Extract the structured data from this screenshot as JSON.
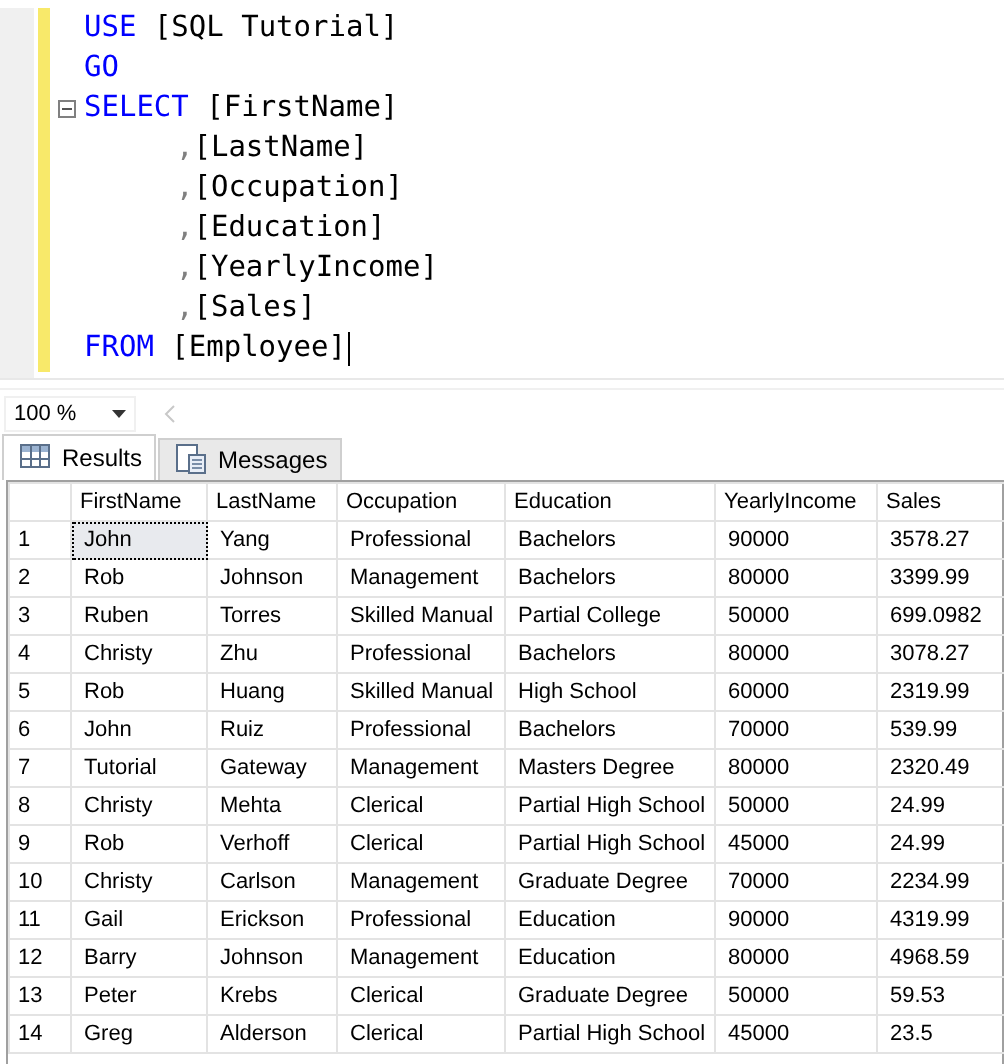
{
  "editor": {
    "lines": [
      {
        "kind": "plain",
        "fold": false,
        "cursor": false,
        "tokens": [
          {
            "text": "USE",
            "kind": "keyword"
          },
          {
            "text": "[SQL Tutorial]",
            "kind": "ident"
          }
        ]
      },
      {
        "kind": "plain",
        "fold": false,
        "cursor": false,
        "tokens": [
          {
            "text": "GO",
            "kind": "keyword"
          }
        ]
      },
      {
        "kind": "plain",
        "fold": true,
        "cursor": false,
        "tokens": [
          {
            "text": "SELECT",
            "kind": "keyword"
          },
          {
            "text": "[FirstName]",
            "kind": "ident"
          }
        ]
      },
      {
        "kind": "continuation",
        "fold": false,
        "cursor": false,
        "tokens": [
          {
            "text": ",",
            "kind": "punct"
          },
          {
            "text": "[LastName]",
            "kind": "ident"
          }
        ]
      },
      {
        "kind": "continuation",
        "fold": false,
        "cursor": false,
        "tokens": [
          {
            "text": ",",
            "kind": "punct"
          },
          {
            "text": "[Occupation]",
            "kind": "ident"
          }
        ]
      },
      {
        "kind": "continuation",
        "fold": false,
        "cursor": false,
        "tokens": [
          {
            "text": ",",
            "kind": "punct"
          },
          {
            "text": "[Education]",
            "kind": "ident"
          }
        ]
      },
      {
        "kind": "continuation",
        "fold": false,
        "cursor": false,
        "tokens": [
          {
            "text": ",",
            "kind": "punct"
          },
          {
            "text": "[YearlyIncome]",
            "kind": "ident"
          }
        ]
      },
      {
        "kind": "continuation",
        "fold": false,
        "cursor": false,
        "tokens": [
          {
            "text": ",",
            "kind": "punct"
          },
          {
            "text": "[Sales]",
            "kind": "ident"
          }
        ]
      },
      {
        "kind": "plain",
        "fold": false,
        "cursor": true,
        "tokens": [
          {
            "text": "FROM",
            "kind": "keyword"
          },
          {
            "text": "[Employee]",
            "kind": "ident"
          }
        ]
      }
    ]
  },
  "zoom": {
    "value": "100 %"
  },
  "tabs": [
    {
      "label": "Results",
      "selected": true
    },
    {
      "label": "Messages",
      "selected": false
    }
  ],
  "table": {
    "columns": [
      "FirstName",
      "LastName",
      "Occupation",
      "Education",
      "YearlyIncome",
      "Sales"
    ],
    "rows": [
      {
        "number": "1",
        "focused": true,
        "cells": [
          "John",
          "Yang",
          "Professional",
          "Bachelors",
          "90000",
          "3578.27"
        ]
      },
      {
        "number": "2",
        "focused": false,
        "cells": [
          "Rob",
          "Johnson",
          "Management",
          "Bachelors",
          "80000",
          "3399.99"
        ]
      },
      {
        "number": "3",
        "focused": false,
        "cells": [
          "Ruben",
          "Torres",
          "Skilled Manual",
          "Partial College",
          "50000",
          "699.0982"
        ]
      },
      {
        "number": "4",
        "focused": false,
        "cells": [
          "Christy",
          "Zhu",
          "Professional",
          "Bachelors",
          "80000",
          "3078.27"
        ]
      },
      {
        "number": "5",
        "focused": false,
        "cells": [
          "Rob",
          "Huang",
          "Skilled Manual",
          "High School",
          "60000",
          "2319.99"
        ]
      },
      {
        "number": "6",
        "focused": false,
        "cells": [
          "John",
          "Ruiz",
          "Professional",
          "Bachelors",
          "70000",
          "539.99"
        ]
      },
      {
        "number": "7",
        "focused": false,
        "cells": [
          "Tutorial",
          "Gateway",
          "Management",
          "Masters Degree",
          "80000",
          "2320.49"
        ]
      },
      {
        "number": "8",
        "focused": false,
        "cells": [
          "Christy",
          "Mehta",
          "Clerical",
          "Partial High School",
          "50000",
          "24.99"
        ]
      },
      {
        "number": "9",
        "focused": false,
        "cells": [
          "Rob",
          "Verhoff",
          "Clerical",
          "Partial High School",
          "45000",
          "24.99"
        ]
      },
      {
        "number": "10",
        "focused": false,
        "cells": [
          "Christy",
          "Carlson",
          "Management",
          "Graduate Degree",
          "70000",
          "2234.99"
        ]
      },
      {
        "number": "11",
        "focused": false,
        "cells": [
          "Gail",
          "Erickson",
          "Professional",
          "Education",
          "90000",
          "4319.99"
        ]
      },
      {
        "number": "12",
        "focused": false,
        "cells": [
          "Barry",
          "Johnson",
          "Management",
          "Education",
          "80000",
          "4968.59"
        ]
      },
      {
        "number": "13",
        "focused": false,
        "cells": [
          "Peter",
          "Krebs",
          "Clerical",
          "Graduate Degree",
          "50000",
          "59.53"
        ]
      },
      {
        "number": "14",
        "focused": false,
        "cells": [
          "Greg",
          "Alderson",
          "Clerical",
          "Partial High School",
          "45000",
          "23.5"
        ]
      }
    ]
  }
}
